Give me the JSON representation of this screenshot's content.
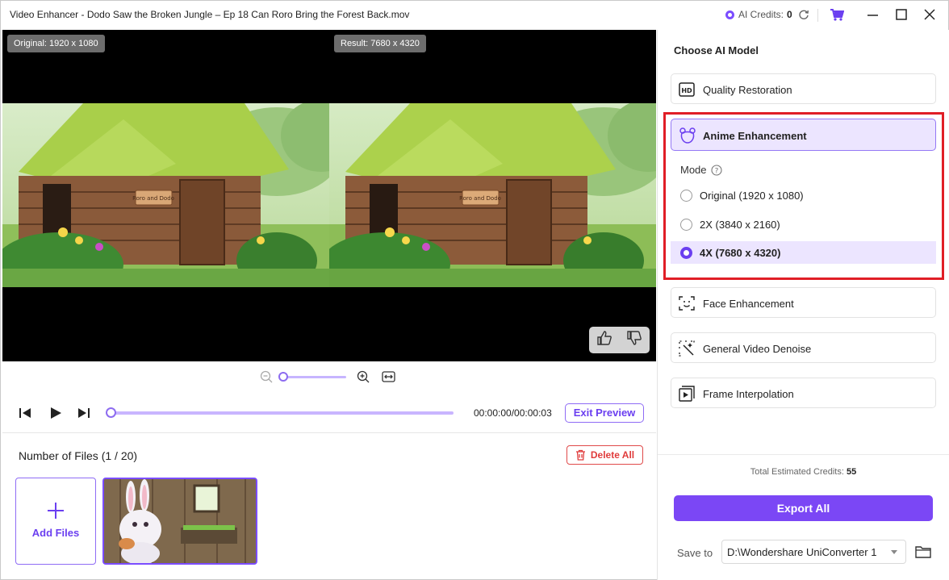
{
  "window": {
    "title": "Video Enhancer - Dodo Saw the Broken Jungle – Ep 18  Can Roro Bring the Forest Back.mov",
    "credits_label": "AI Credits:",
    "credits_value": "0"
  },
  "preview": {
    "original_badge": "Original: 1920 x 1080",
    "result_badge": "Result: 7680 x 4320",
    "sign_text": "Roro and Dodo"
  },
  "zoom": {
    "level": 0.0
  },
  "transport": {
    "timecode": "00:00:00/00:00:03",
    "exit_preview": "Exit Preview",
    "progress": 0.0
  },
  "files": {
    "count_label": "Number of Files (1 / 20)",
    "delete_all": "Delete All",
    "add_files": "Add Files"
  },
  "panel": {
    "title": "Choose AI Model",
    "models": [
      {
        "label": "Quality Restoration",
        "icon": "hd-icon"
      },
      {
        "label": "Anime Enhancement",
        "icon": "bear-icon"
      },
      {
        "label": "Face Enhancement",
        "icon": "face-scan-icon"
      },
      {
        "label": "General Video Denoise",
        "icon": "denoise-icon"
      },
      {
        "label": "Frame Interpolation",
        "icon": "frame-icon"
      }
    ],
    "mode_label": "Mode",
    "modes": [
      {
        "label": "Original (1920 x 1080)",
        "selected": false
      },
      {
        "label": "2X (3840 x 2160)",
        "selected": false
      },
      {
        "label": "4X (7680 x 4320)",
        "selected": true
      }
    ],
    "total_label": "Total Estimated Credits:",
    "total_value": "55",
    "export_all": "Export All",
    "save_to_label": "Save to",
    "save_path": "D:\\Wondershare UniConverter 1"
  },
  "colors": {
    "accent": "#7b47f5",
    "accent_light": "#ece5ff",
    "highlight_box": "#e01e26",
    "delete": "#e03b3b"
  }
}
